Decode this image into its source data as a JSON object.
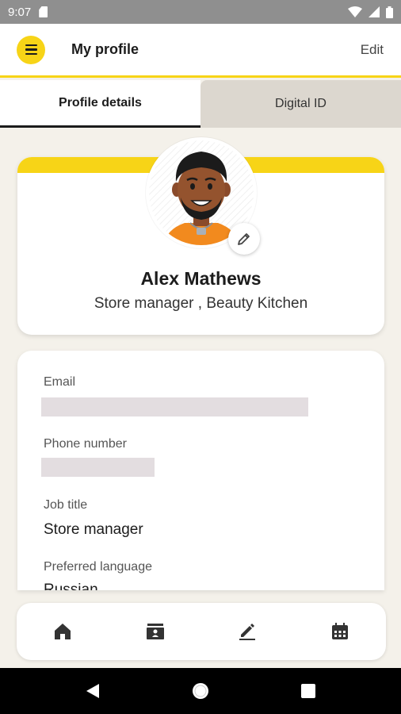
{
  "status_bar": {
    "time": "9:07"
  },
  "app_bar": {
    "title": "My profile",
    "edit_label": "Edit"
  },
  "tabs": [
    {
      "label": "Profile details",
      "active": true
    },
    {
      "label": "Digital ID",
      "active": false
    }
  ],
  "profile": {
    "name": "Alex Mathews",
    "role": "Store manager , Beauty Kitchen"
  },
  "details": {
    "email_label": "Email",
    "phone_label": "Phone number",
    "job_title_label": "Job title",
    "job_title_value": "Store manager",
    "language_label": "Preferred language",
    "language_value": "Russian"
  },
  "bottom_nav": [
    {
      "icon": "home-icon"
    },
    {
      "icon": "store-icon"
    },
    {
      "icon": "edit-icon"
    },
    {
      "icon": "calendar-icon"
    }
  ],
  "colors": {
    "accent": "#f7d417",
    "background": "#f4f1ea",
    "inactive_tab": "#dcd7cf",
    "redacted": "#e3dde0"
  }
}
